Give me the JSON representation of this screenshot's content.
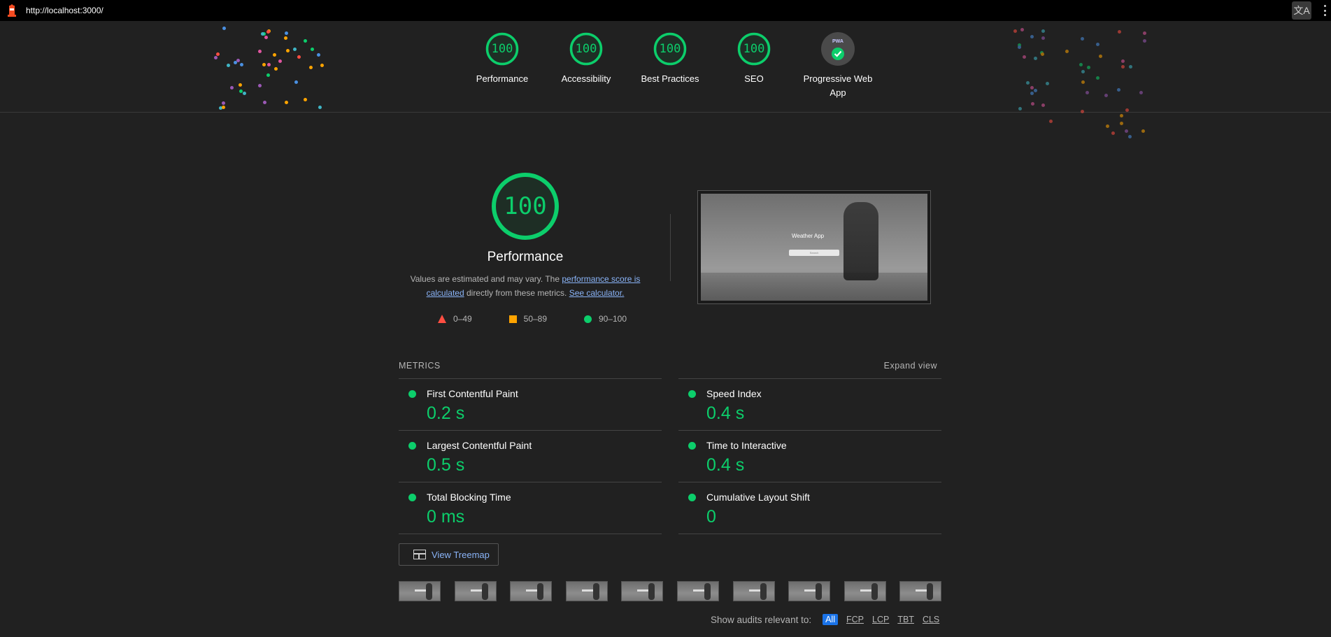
{
  "browser": {
    "url": "http://localhost:3000/"
  },
  "header": {
    "gauges": [
      {
        "score": "100",
        "label": "Performance"
      },
      {
        "score": "100",
        "label": "Accessibility"
      },
      {
        "score": "100",
        "label": "Best Practices"
      },
      {
        "score": "100",
        "label": "SEO"
      },
      {
        "badge": "PWA",
        "label": "Progressive Web App"
      }
    ]
  },
  "performance": {
    "score": "100",
    "title": "Performance",
    "desc_prefix": "Values are estimated and may vary. The ",
    "desc_link": "performance score is calculated",
    "desc_middle": " directly from these metrics. ",
    "desc_calc_link": "See calculator.",
    "legend": [
      {
        "range": "0–49",
        "color": "#ff4e42"
      },
      {
        "range": "50–89",
        "color": "#ffa400"
      },
      {
        "range": "90–100",
        "color": "#0cce6b"
      }
    ],
    "screenshot": {
      "title": "Weather App",
      "input_placeholder": "Search"
    }
  },
  "metrics": {
    "heading": "METRICS",
    "expand_label": "Expand view",
    "items": [
      {
        "name": "First Contentful Paint",
        "value": "0.2 s"
      },
      {
        "name": "Speed Index",
        "value": "0.4 s"
      },
      {
        "name": "Largest Contentful Paint",
        "value": "0.5 s"
      },
      {
        "name": "Time to Interactive",
        "value": "0.4 s"
      },
      {
        "name": "Total Blocking Time",
        "value": "0 ms"
      },
      {
        "name": "Cumulative Layout Shift",
        "value": "0"
      }
    ]
  },
  "treemap": {
    "label": "View Treemap"
  },
  "audits_filter": {
    "label": "Show audits relevant to:",
    "chips": [
      "All",
      "FCP",
      "LCP",
      "TBT",
      "CLS"
    ],
    "active": "All"
  },
  "colors": {
    "pass": "#0cce6b",
    "average": "#ffa400",
    "fail": "#ff4e42",
    "link": "#8ab4f8",
    "background": "#212121"
  }
}
